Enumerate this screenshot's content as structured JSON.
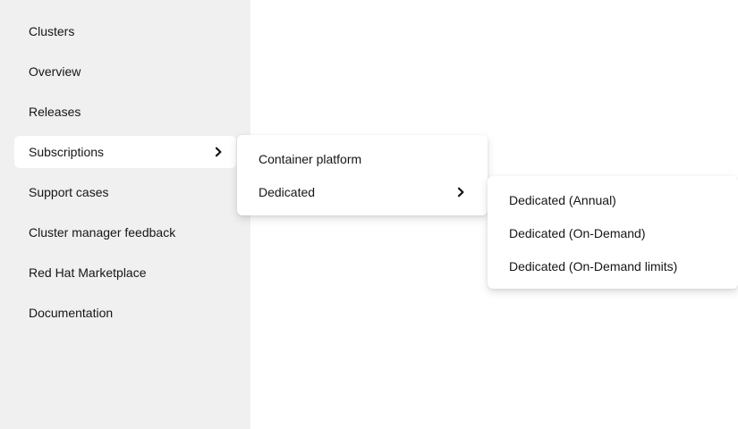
{
  "sidebar": {
    "items": [
      {
        "label": "Clusters"
      },
      {
        "label": "Overview"
      },
      {
        "label": "Releases"
      },
      {
        "label": "Subscriptions"
      },
      {
        "label": "Support cases"
      },
      {
        "label": "Cluster manager feedback"
      },
      {
        "label": "Red Hat Marketplace"
      },
      {
        "label": "Documentation"
      }
    ]
  },
  "submenu": {
    "items": [
      {
        "label": "Container platform"
      },
      {
        "label": "Dedicated"
      }
    ]
  },
  "flyout": {
    "items": [
      {
        "label": "Dedicated (Annual)"
      },
      {
        "label": "Dedicated (On-Demand)"
      },
      {
        "label": "Dedicated (On-Demand limits)"
      }
    ]
  },
  "colors": {
    "sidebar_background": "#f0f0f0",
    "active_item_background": "#ffffff",
    "text": "#151515"
  },
  "icons": {
    "expand": "chevron-right-icon"
  }
}
